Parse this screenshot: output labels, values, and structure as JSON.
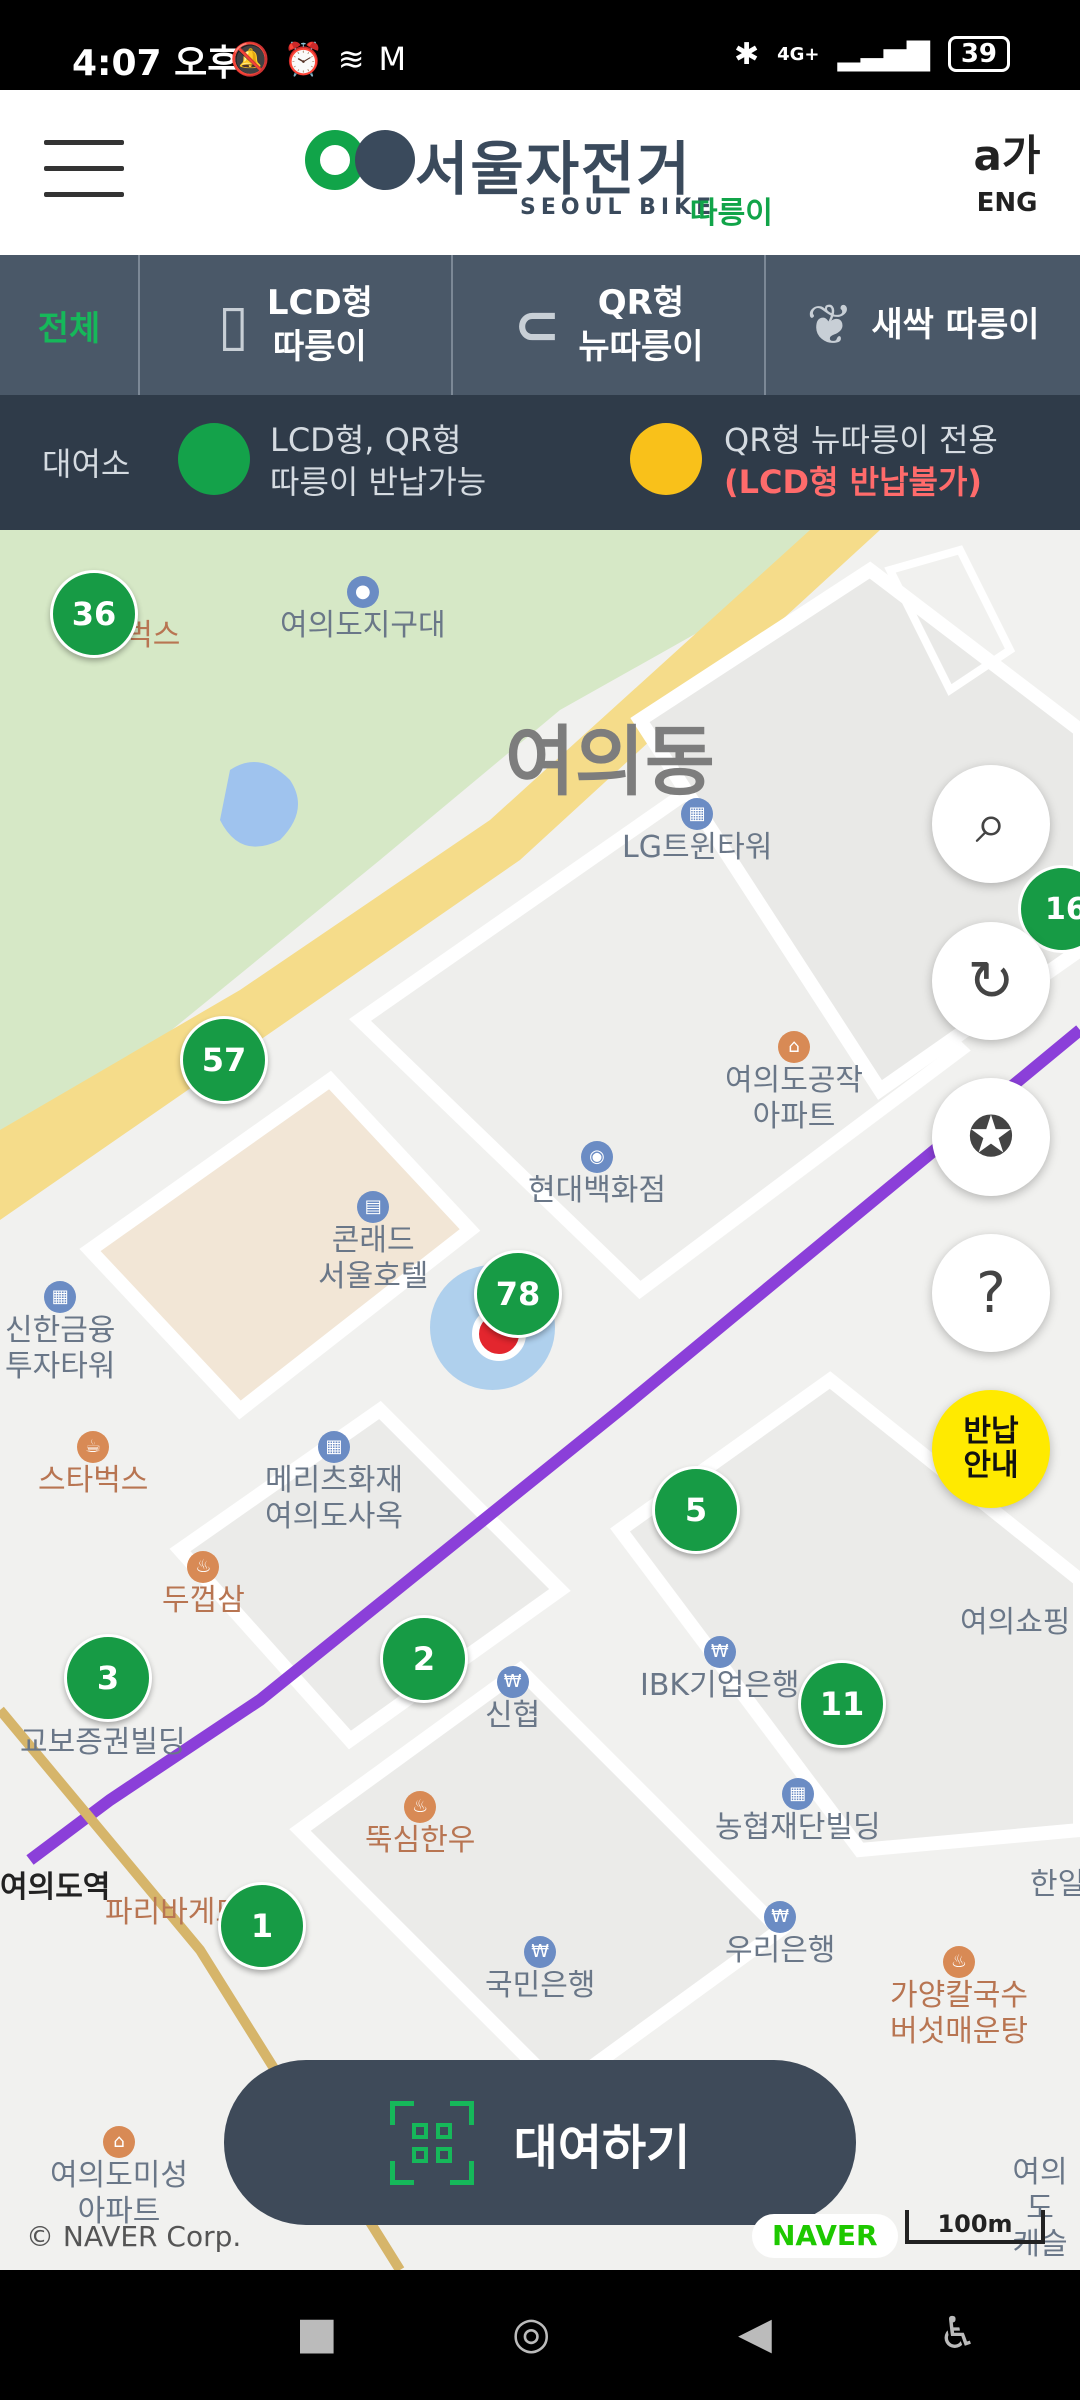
{
  "status": {
    "time": "4:07 오후",
    "battery": "39",
    "network": "4G+",
    "icons": [
      "mute-icon",
      "alarm-icon",
      "wifi-icon",
      "gmail-icon",
      "bluetooth-icon",
      "signal-icon"
    ]
  },
  "header": {
    "logo_text": "서울자전거",
    "logo_sub": "SEOUL BIKE",
    "logo_brand": "따릉이",
    "lang_glyph": "a가",
    "lang_label": "ENG"
  },
  "tabs": [
    {
      "label": "전체",
      "active": true
    },
    {
      "label": "LCD형\n따릉이",
      "active": false
    },
    {
      "label": "QR형\n뉴따릉이",
      "active": false
    },
    {
      "label": "새싹 따릉이",
      "active": false
    }
  ],
  "legend": {
    "title": "대여소",
    "green_line1": "LCD형, QR형",
    "green_line2": "따릉이 반납가능",
    "yellow_line1": "QR형 뉴따릉이 전용",
    "yellow_line2": "(LCD형 반납불가)"
  },
  "map": {
    "district": "여의동",
    "pois": [
      "여의도지구대",
      "스타벅스",
      "LG트윈타워",
      "여의도공작\n아파트",
      "현대백화점",
      "콘래드\n서울호텔",
      "신한금융\n투자타워",
      "스타벅스",
      "메리츠화재\n여의도사옥",
      "두껍삼",
      "교보증권빌딩",
      "신협",
      "IBK기업은행",
      "농협재단빌딩",
      "뚝심한우",
      "여의도역",
      "파리바게뜨",
      "국민은행",
      "우리은행",
      "가양칼국수\n버섯매운탕",
      "여의도미성\n아파트",
      "여의쇼핑",
      "한일",
      "여의도\n캐슬"
    ],
    "clusters": [
      "36",
      "57",
      "78",
      "5",
      "2",
      "3",
      "11",
      "1",
      "16"
    ],
    "fabs": {
      "return_label": "반납\n안내"
    },
    "rent_button": "대여하기",
    "credit": "© NAVER Corp.",
    "naver_logo": "NAVER",
    "scale": "100m"
  },
  "colors": {
    "green": "#179b45",
    "yellow": "#f9c11a",
    "header_dark": "#4a5868",
    "legend_bg": "#2f3b49",
    "subway_line": "#8b3fd9"
  }
}
